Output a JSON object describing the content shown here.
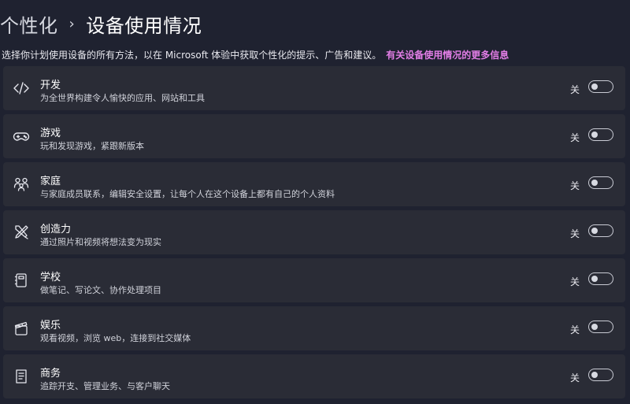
{
  "header": {
    "parent": "个性化",
    "separator": "›",
    "current": "设备使用情况"
  },
  "description": {
    "text": "选择你计划使用设备的所有方法，以在 Microsoft 体验中获取个性化的提示、广告和建议。",
    "link": "有关设备使用情况的更多信息"
  },
  "items": [
    {
      "title": "开发",
      "subtitle": "为全世界构建令人愉快的应用、网站和工具",
      "state": "关",
      "icon": "code-icon",
      "on": false
    },
    {
      "title": "游戏",
      "subtitle": "玩和发现游戏，紧跟新版本",
      "state": "关",
      "icon": "gamepad-icon",
      "on": false
    },
    {
      "title": "家庭",
      "subtitle": "与家庭成员联系，编辑安全设置，让每个人在这个设备上都有自己的个人资料",
      "state": "关",
      "icon": "family-icon",
      "on": false
    },
    {
      "title": "创造力",
      "subtitle": "通过照片和视频将想法变为现实",
      "state": "关",
      "icon": "creativity-icon",
      "on": false
    },
    {
      "title": "学校",
      "subtitle": "做笔记、写论文、协作处理项目",
      "state": "关",
      "icon": "notebook-icon",
      "on": false
    },
    {
      "title": "娱乐",
      "subtitle": "观看视频，浏览 web，连接到社交媒体",
      "state": "关",
      "icon": "clapperboard-icon",
      "on": false
    },
    {
      "title": "商务",
      "subtitle": "追踪开支、管理业务、与客户聊天",
      "state": "关",
      "icon": "document-icon",
      "on": false
    }
  ]
}
